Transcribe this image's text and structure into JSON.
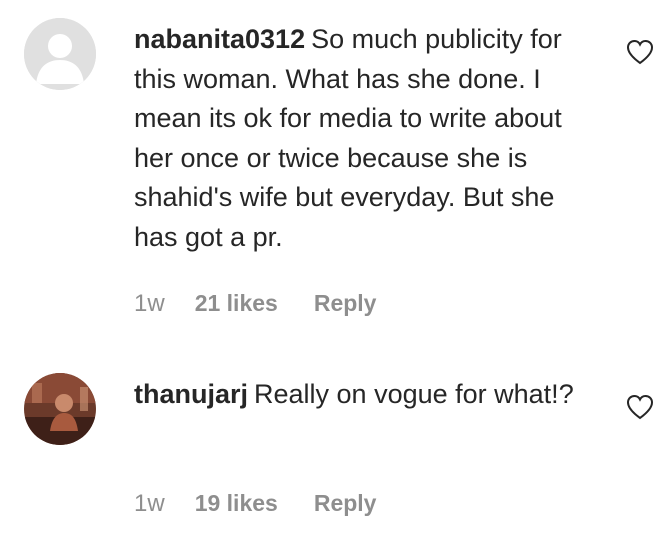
{
  "comments": [
    {
      "username": "nabanita0312",
      "text": "So much publicity for this woman. What has she done. I mean its ok for media to write about her once or twice because she is shahid's wife but everyday. But she has got a pr.",
      "time": "1w",
      "likes": "21 likes",
      "reply_label": "Reply",
      "avatar_icon": "default-avatar-icon",
      "like_icon": "heart-outline-icon"
    },
    {
      "username": "thanujarj",
      "text": "Really on vogue for what!?",
      "time": "1w",
      "likes": "19 likes",
      "reply_label": "Reply",
      "avatar_icon": "profile-photo",
      "like_icon": "heart-outline-icon"
    }
  ],
  "colors": {
    "text": "#262626",
    "meta": "#8e8e8e",
    "avatar_placeholder": "#e0e0e0"
  }
}
